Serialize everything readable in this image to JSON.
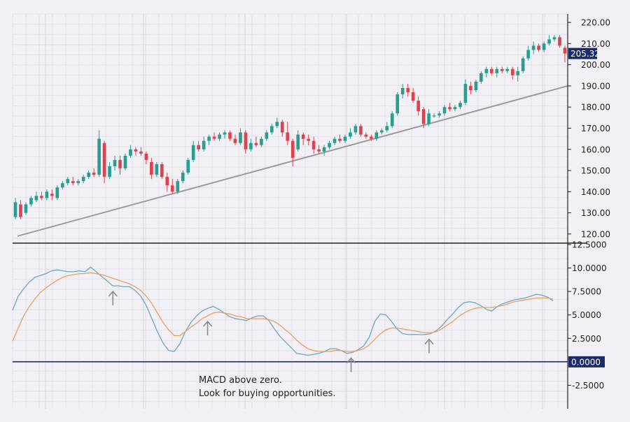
{
  "chart_data": [
    {
      "type": "candlestick",
      "panel": "price",
      "y_ticks": [
        120,
        130,
        140,
        150,
        160,
        170,
        180,
        190,
        200,
        210,
        220
      ],
      "y_tick_labels": [
        "120.00",
        "130.00",
        "140.00",
        "150.00",
        "160.00",
        "170.00",
        "180.00",
        "190.00",
        "200.00",
        "210.00",
        "220.00"
      ],
      "ylim": [
        116,
        224
      ],
      "last_price_label": "205.32",
      "last_price": 205.32,
      "trendline": {
        "from_value": 119,
        "to_value": 190
      },
      "colors": {
        "up": "#2a9d8f",
        "down": "#e0414d",
        "trendline": "#9b9ba3",
        "price_badge": "#1a2a6c"
      },
      "candles": [
        {
          "o": 128,
          "h": 137,
          "l": 127,
          "c": 135
        },
        {
          "o": 134,
          "h": 136,
          "l": 127,
          "c": 128
        },
        {
          "o": 130,
          "h": 135,
          "l": 129,
          "c": 134
        },
        {
          "o": 134,
          "h": 138,
          "l": 133,
          "c": 137
        },
        {
          "o": 136,
          "h": 140,
          "l": 135,
          "c": 138
        },
        {
          "o": 138,
          "h": 140,
          "l": 136,
          "c": 137
        },
        {
          "o": 137,
          "h": 141,
          "l": 136,
          "c": 140
        },
        {
          "o": 139,
          "h": 141,
          "l": 136,
          "c": 138
        },
        {
          "o": 137,
          "h": 143,
          "l": 136,
          "c": 142
        },
        {
          "o": 142,
          "h": 145,
          "l": 141,
          "c": 144
        },
        {
          "o": 144,
          "h": 147,
          "l": 143,
          "c": 146
        },
        {
          "o": 145,
          "h": 147,
          "l": 143,
          "c": 144
        },
        {
          "o": 144,
          "h": 146,
          "l": 143,
          "c": 145
        },
        {
          "o": 145,
          "h": 148,
          "l": 144,
          "c": 147
        },
        {
          "o": 147,
          "h": 150,
          "l": 146,
          "c": 149
        },
        {
          "o": 149,
          "h": 151,
          "l": 147,
          "c": 148
        },
        {
          "o": 148,
          "h": 169,
          "l": 147,
          "c": 165
        },
        {
          "o": 163,
          "h": 164,
          "l": 144,
          "c": 147
        },
        {
          "o": 147,
          "h": 154,
          "l": 146,
          "c": 152
        },
        {
          "o": 152,
          "h": 157,
          "l": 150,
          "c": 155
        },
        {
          "o": 155,
          "h": 157,
          "l": 148,
          "c": 151
        },
        {
          "o": 151,
          "h": 158,
          "l": 150,
          "c": 157
        },
        {
          "o": 157,
          "h": 162,
          "l": 156,
          "c": 160
        },
        {
          "o": 160,
          "h": 161,
          "l": 157,
          "c": 159
        },
        {
          "o": 159,
          "h": 161,
          "l": 157,
          "c": 158
        },
        {
          "o": 158,
          "h": 159,
          "l": 153,
          "c": 155
        },
        {
          "o": 154,
          "h": 156,
          "l": 146,
          "c": 148
        },
        {
          "o": 148,
          "h": 154,
          "l": 147,
          "c": 153
        },
        {
          "o": 153,
          "h": 154,
          "l": 146,
          "c": 147
        },
        {
          "o": 147,
          "h": 149,
          "l": 140,
          "c": 143
        },
        {
          "o": 143,
          "h": 146,
          "l": 139,
          "c": 140
        },
        {
          "o": 140,
          "h": 146,
          "l": 139,
          "c": 145
        },
        {
          "o": 145,
          "h": 150,
          "l": 144,
          "c": 149
        },
        {
          "o": 149,
          "h": 156,
          "l": 148,
          "c": 155
        },
        {
          "o": 155,
          "h": 164,
          "l": 154,
          "c": 162
        },
        {
          "o": 162,
          "h": 164,
          "l": 159,
          "c": 160
        },
        {
          "o": 160,
          "h": 166,
          "l": 159,
          "c": 164
        },
        {
          "o": 164,
          "h": 167,
          "l": 162,
          "c": 166
        },
        {
          "o": 166,
          "h": 168,
          "l": 164,
          "c": 165
        },
        {
          "o": 165,
          "h": 168,
          "l": 164,
          "c": 167
        },
        {
          "o": 167,
          "h": 169,
          "l": 165,
          "c": 168
        },
        {
          "o": 168,
          "h": 169,
          "l": 164,
          "c": 165
        },
        {
          "o": 165,
          "h": 167,
          "l": 162,
          "c": 163
        },
        {
          "o": 163,
          "h": 170,
          "l": 162,
          "c": 168
        },
        {
          "o": 168,
          "h": 169,
          "l": 158,
          "c": 160
        },
        {
          "o": 160,
          "h": 165,
          "l": 159,
          "c": 163
        },
        {
          "o": 163,
          "h": 166,
          "l": 161,
          "c": 162
        },
        {
          "o": 162,
          "h": 166,
          "l": 161,
          "c": 165
        },
        {
          "o": 165,
          "h": 169,
          "l": 164,
          "c": 168
        },
        {
          "o": 168,
          "h": 172,
          "l": 167,
          "c": 171
        },
        {
          "o": 171,
          "h": 175,
          "l": 170,
          "c": 173
        },
        {
          "o": 173,
          "h": 174,
          "l": 166,
          "c": 168
        },
        {
          "o": 168,
          "h": 173,
          "l": 162,
          "c": 164
        },
        {
          "o": 164,
          "h": 165,
          "l": 152,
          "c": 156
        },
        {
          "o": 160,
          "h": 169,
          "l": 159,
          "c": 167
        },
        {
          "o": 167,
          "h": 168,
          "l": 162,
          "c": 165
        },
        {
          "o": 165,
          "h": 167,
          "l": 162,
          "c": 164
        },
        {
          "o": 164,
          "h": 166,
          "l": 158,
          "c": 160
        },
        {
          "o": 160,
          "h": 162,
          "l": 158,
          "c": 159
        },
        {
          "o": 159,
          "h": 162,
          "l": 157,
          "c": 161
        },
        {
          "o": 161,
          "h": 164,
          "l": 160,
          "c": 163
        },
        {
          "o": 163,
          "h": 166,
          "l": 162,
          "c": 165
        },
        {
          "o": 165,
          "h": 167,
          "l": 163,
          "c": 164
        },
        {
          "o": 164,
          "h": 167,
          "l": 163,
          "c": 166
        },
        {
          "o": 166,
          "h": 170,
          "l": 165,
          "c": 168
        },
        {
          "o": 168,
          "h": 172,
          "l": 167,
          "c": 171
        },
        {
          "o": 171,
          "h": 172,
          "l": 166,
          "c": 167
        },
        {
          "o": 167,
          "h": 168,
          "l": 165,
          "c": 166
        },
        {
          "o": 166,
          "h": 167,
          "l": 164,
          "c": 165
        },
        {
          "o": 165,
          "h": 169,
          "l": 164,
          "c": 168
        },
        {
          "o": 168,
          "h": 170,
          "l": 167,
          "c": 169
        },
        {
          "o": 169,
          "h": 173,
          "l": 168,
          "c": 171
        },
        {
          "o": 171,
          "h": 178,
          "l": 170,
          "c": 177
        },
        {
          "o": 177,
          "h": 187,
          "l": 176,
          "c": 186
        },
        {
          "o": 186,
          "h": 191,
          "l": 184,
          "c": 189
        },
        {
          "o": 189,
          "h": 191,
          "l": 185,
          "c": 187
        },
        {
          "o": 187,
          "h": 189,
          "l": 182,
          "c": 183
        },
        {
          "o": 183,
          "h": 185,
          "l": 176,
          "c": 178
        },
        {
          "o": 179,
          "h": 180,
          "l": 170,
          "c": 172
        },
        {
          "o": 172,
          "h": 179,
          "l": 171,
          "c": 177
        },
        {
          "o": 176,
          "h": 177,
          "l": 175,
          "c": 176
        },
        {
          "o": 176,
          "h": 178,
          "l": 175,
          "c": 177
        },
        {
          "o": 177,
          "h": 181,
          "l": 176,
          "c": 180
        },
        {
          "o": 180,
          "h": 182,
          "l": 178,
          "c": 179
        },
        {
          "o": 179,
          "h": 181,
          "l": 178,
          "c": 180
        },
        {
          "o": 180,
          "h": 183,
          "l": 179,
          "c": 182
        },
        {
          "o": 182,
          "h": 193,
          "l": 181,
          "c": 191
        },
        {
          "o": 190,
          "h": 192,
          "l": 186,
          "c": 188
        },
        {
          "o": 188,
          "h": 193,
          "l": 187,
          "c": 192
        },
        {
          "o": 192,
          "h": 197,
          "l": 191,
          "c": 196
        },
        {
          "o": 196,
          "h": 199,
          "l": 194,
          "c": 198
        },
        {
          "o": 198,
          "h": 199,
          "l": 195,
          "c": 196
        },
        {
          "o": 196,
          "h": 199,
          "l": 194,
          "c": 198
        },
        {
          "o": 198,
          "h": 199,
          "l": 196,
          "c": 197
        },
        {
          "o": 197,
          "h": 199,
          "l": 196,
          "c": 198
        },
        {
          "o": 198,
          "h": 199,
          "l": 193,
          "c": 195
        },
        {
          "o": 195,
          "h": 199,
          "l": 192,
          "c": 197
        },
        {
          "o": 197,
          "h": 204,
          "l": 196,
          "c": 203
        },
        {
          "o": 203,
          "h": 209,
          "l": 202,
          "c": 207
        },
        {
          "o": 207,
          "h": 211,
          "l": 205,
          "c": 209
        },
        {
          "o": 209,
          "h": 210,
          "l": 206,
          "c": 207
        },
        {
          "o": 207,
          "h": 211,
          "l": 206,
          "c": 210
        },
        {
          "o": 210,
          "h": 214,
          "l": 209,
          "c": 212
        },
        {
          "o": 212,
          "h": 214,
          "l": 211,
          "c": 213
        },
        {
          "o": 213,
          "h": 214,
          "l": 208,
          "c": 209
        },
        {
          "o": 208,
          "h": 209,
          "l": 201,
          "c": 205.32
        }
      ]
    },
    {
      "type": "line",
      "panel": "macd",
      "y_ticks": [
        -2.5,
        0,
        2.5,
        5,
        7.5,
        10,
        12.5
      ],
      "y_tick_labels": [
        "-2.5000",
        "0.0000",
        "2.5000",
        "5.0000",
        "7.5000",
        "10.0000",
        "12.5000"
      ],
      "ylim": [
        -5,
        12.5
      ],
      "zero_label": "0.0000",
      "x": [
        0,
        4,
        8,
        12,
        16,
        20,
        24,
        28,
        32,
        36,
        40,
        44,
        48,
        52,
        56,
        60,
        64,
        68,
        72,
        76,
        80,
        84,
        88,
        92,
        96,
        100,
        104,
        108,
        112,
        116,
        120,
        124,
        128,
        132,
        136,
        140,
        144,
        148,
        152,
        156,
        160,
        164,
        168,
        172,
        176,
        180,
        184,
        188,
        192,
        196,
        200,
        204,
        208,
        212,
        216,
        220,
        224,
        228,
        232,
        236,
        240,
        244,
        248,
        252,
        256,
        260,
        264,
        268,
        272,
        276,
        280,
        284,
        288,
        292,
        296,
        300,
        304,
        308,
        312,
        316,
        320,
        324,
        328,
        332,
        336,
        340,
        344,
        348,
        352,
        356,
        360,
        364,
        368,
        372,
        376,
        380,
        384,
        388,
        392,
        396
      ],
      "series": [
        {
          "color": "#6aa8c4",
          "values": [
            5.5,
            7.0,
            7.8,
            8.5,
            9.0,
            9.2,
            9.4,
            9.7,
            9.8,
            9.7,
            9.6,
            9.6,
            9.7,
            9.6,
            10.1,
            9.6,
            9.1,
            8.6,
            8.1,
            8.1,
            8.0,
            8.0,
            7.6,
            7.0,
            6.0,
            4.6,
            3.2,
            2.0,
            1.2,
            1.1,
            1.9,
            3.2,
            4.2,
            4.9,
            5.4,
            5.7,
            5.9,
            5.6,
            5.2,
            4.8,
            4.6,
            4.5,
            4.4,
            4.7,
            4.9,
            4.9,
            4.4,
            3.5,
            2.7,
            2.1,
            1.5,
            0.9,
            0.8,
            0.7,
            0.8,
            0.9,
            1.1,
            1.4,
            1.4,
            1.2,
            0.9,
            1.0,
            1.3,
            1.7,
            2.6,
            4.3,
            5.1,
            5.0,
            4.3,
            3.5,
            3.0,
            2.9,
            2.9,
            2.9,
            2.9,
            3.0,
            3.3,
            3.8,
            4.5,
            5.1,
            5.8,
            6.3,
            6.4,
            6.3,
            6.0,
            5.6,
            5.4,
            5.9,
            6.2,
            6.4,
            6.6,
            6.7,
            6.8,
            7.0,
            7.2,
            7.1,
            6.9,
            6.5
          ],
          "label_index": null
        },
        {
          "color": "#e8a267",
          "values": [
            2.2,
            3.6,
            4.9,
            5.9,
            6.7,
            7.4,
            7.9,
            8.3,
            8.7,
            9.0,
            9.2,
            9.3,
            9.4,
            9.4,
            9.5,
            9.4,
            9.3,
            9.1,
            8.9,
            8.7,
            8.5,
            8.3,
            8.0,
            7.6,
            7.0,
            6.2,
            5.2,
            4.2,
            3.4,
            2.8,
            2.8,
            3.2,
            3.7,
            4.1,
            4.6,
            4.9,
            5.2,
            5.3,
            5.2,
            5.1,
            4.9,
            4.8,
            4.6,
            4.6,
            4.6,
            4.6,
            4.5,
            4.3,
            3.9,
            3.4,
            2.9,
            2.3,
            1.8,
            1.4,
            1.2,
            1.1,
            1.1,
            1.1,
            1.2,
            1.2,
            1.1,
            1.1,
            1.2,
            1.4,
            1.8,
            2.4,
            3.0,
            3.4,
            3.6,
            3.6,
            3.5,
            3.4,
            3.3,
            3.2,
            3.1,
            3.1,
            3.2,
            3.5,
            3.9,
            4.3,
            4.8,
            5.2,
            5.5,
            5.7,
            5.8,
            5.8,
            5.8,
            5.9,
            6.0,
            6.2,
            6.4,
            6.5,
            6.6,
            6.7,
            6.8,
            6.8,
            6.8,
            6.7
          ]
        }
      ],
      "arrows_at_x": [
        72,
        140,
        243,
        299
      ],
      "annotation": [
        "MACD above zero.",
        "Look for buying opportunities."
      ]
    }
  ]
}
